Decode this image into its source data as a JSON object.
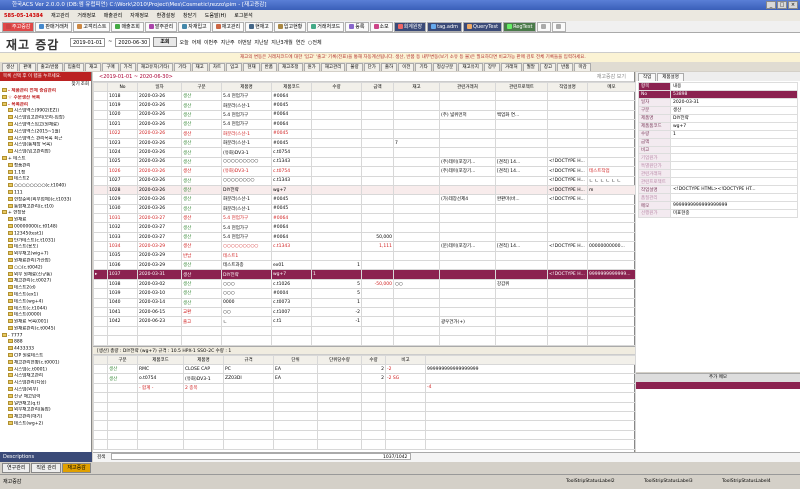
{
  "window": {
    "title": "한국ACS Ver 2.0.0.0 (DB:엠 유럽피언) C:\\Work\\2010\\Project\\Mes\\Cosmetic\\rezzo\\pim - [재고증감]",
    "buttons": [
      "_",
      "□",
      "×"
    ]
  },
  "menu": {
    "brand": "585-05-14384",
    "items": [
      "재고관리",
      "거래정보",
      "매출관리",
      "자재정보",
      "환경설정",
      "창닫기",
      "도움말(H)",
      "로그분석"
    ]
  },
  "toolbar": {
    "items": [
      "주고증감",
      "판매거래처",
      "고객리스트",
      "매출조회",
      "발주관리",
      "자재입고",
      "재고관리",
      "현재고",
      "입고현황",
      "거래처코드",
      "등록",
      "소모",
      "회계원장",
      "tag.adm",
      "QueryTest",
      "RegTest",
      "",
      ""
    ]
  },
  "page": {
    "title": "재고 증감",
    "date_from": "2019-01-01",
    "date_to": "2020-06-30",
    "query_label": "조회",
    "filters": [
      "오늘",
      "어제",
      "이번주",
      "지난주",
      "이번달",
      "지난달",
      "지난3개월",
      "연간",
      "○전체"
    ]
  },
  "notice": "재고의 변동은 거래처코드에 대한 '입고' '출고' 기록(전표)을 통해 자동계산됩니다. 생산, 반품 등 내부변동(보기 소유 등 불)은 필요하다면 비교가능 판매 검토 전체 기록들을 입력하세요.",
  "subtabs": [
    "생산",
    "판매",
    "출고/반품",
    "입출력",
    "재고",
    "구매",
    "가격",
    "재고유지(기타)",
    "기타",
    "재고",
    "차트",
    "입고",
    "현재",
    "반품",
    "재고조정",
    "원가",
    "재고관리",
    "불량",
    "단가",
    "출하",
    "이전",
    "기타",
    "정상구분",
    "재고유지",
    "장부",
    "거래처",
    "월말",
    "창고",
    "반품",
    "마감"
  ],
  "left": {
    "header": "목록 선택 후 이 탭을 누르세요.",
    "search": [
      "찾기",
      "조회"
    ],
    "tree": [
      "- 제품관리 전체 증감관리",
      "☆ 주문생산 목록",
      "- 목록관리",
      "시스템엑스(9902(EZ))",
      "시스템입고관리(보라-입장)",
      "시스템엑스입고(원재료)",
      "시스템엑스(2015~1월)",
      "시스템엑스 관리목록 최근",
      "시스템(통제장 목록)",
      "시스템(입고관리합)",
      "+ 테스트",
      "정품관리",
      "1.1정",
      "테스트2",
      "○○○○○○○○(c.t1040)",
      "111",
      "현장준비(외부업체)(c.t1033)",
      "통합재고관리(c.t10)",
      "+ 현장용",
      "원재료",
      "00000000(c.t0148)",
      "12345(test1)",
      "단가테스트(c.t1031)",
      "테스트(용도)",
      "외부재고(wig+7)",
      "원재료관리(가산합)",
      "○○(c.t0042)",
      "외부 원재료(신규통)",
      "재고관리(c.t0027)",
      "테스트2(d)",
      "테스트(ex1)",
      "테스트(wg+4)",
      "테스트(c.t1044)",
      "테스트(0000)",
      "원재료 목록(001)",
      "원재료관리(c.t0045)",
      "- 7777",
      "888",
      "4433333",
      "CIP 원료테스트",
      "재고관리현황(c.t0001)",
      "시스템(c.t0001)",
      "시스템재고관리",
      "시스템관리(다음)",
      "시스템(외부)",
      "신규 재고입력",
      "일반재고(q.t)",
      "외부재고관리(통합)",
      "재고관리(대기)",
      "테스트(wg+2)"
    ],
    "footer": "Descriptions"
  },
  "grid": {
    "range": "<2019-01-01 ~ 2020-06-30>",
    "range_right": "재고증감 보기",
    "columns": [
      "No",
      "일자",
      "구분",
      "제품명",
      "제품코드",
      "수량",
      "금액",
      "재고",
      "관련거래처",
      "관련프로젝트",
      "작업설명",
      "메모"
    ],
    "rows": [
      {
        "no": "1018",
        "date": "2020-03-26",
        "type": "생산",
        "name": "5.4 현업가구",
        "code": "#0064",
        "qty": "",
        "amt": "",
        "stock": "",
        "partner": "",
        "project": "",
        "desc": "",
        "memo": "",
        "cls": "",
        "typecls": "green",
        "namecls": ""
      },
      {
        "no": "1019",
        "date": "2020-03-26",
        "type": "생산",
        "name": "화분라(스산-1",
        "code": "#0045",
        "qty": "",
        "amt": "",
        "stock": "",
        "partner": "",
        "project": "",
        "desc": "",
        "memo": "",
        "cls": "",
        "typecls": "green",
        "namecls": ""
      },
      {
        "no": "1020",
        "date": "2020-03-26",
        "type": "생산",
        "name": "5.4 현업가구",
        "code": "#0064",
        "qty": "",
        "amt": "",
        "stock": "",
        "partner": "(주) 넓위먼저",
        "project": "백엄화 연...",
        "desc": "",
        "memo": "",
        "cls": "",
        "typecls": "green",
        "namecls": ""
      },
      {
        "no": "1021",
        "date": "2020-03-26",
        "type": "생산",
        "name": "5.4 현업가구",
        "code": "#0064",
        "qty": "",
        "amt": "",
        "stock": "",
        "partner": "",
        "project": "",
        "desc": "",
        "memo": "",
        "cls": "",
        "typecls": "green",
        "namecls": ""
      },
      {
        "no": "1022",
        "date": "2020-03-26",
        "type": "생산",
        "name": "화분라(스산-1",
        "code": "#0045",
        "qty": "",
        "amt": "",
        "stock": "",
        "partner": "",
        "project": "",
        "desc": "",
        "memo": "",
        "cls": "red",
        "typecls": "red",
        "namecls": "red"
      },
      {
        "no": "1023",
        "date": "2020-03-26",
        "type": "생산",
        "name": "화분라(스산-1",
        "code": "#0045",
        "qty": "",
        "amt": "",
        "stock": "7",
        "partner": "",
        "project": "",
        "desc": "",
        "memo": "",
        "cls": "",
        "typecls": "green",
        "namecls": ""
      },
      {
        "no": "1024",
        "date": "2020-03-26",
        "type": "생산",
        "name": "(유화)DV3-1",
        "code": "c.t0754",
        "qty": "",
        "amt": "",
        "stock": "",
        "partner": "",
        "project": "",
        "desc": "",
        "memo": "",
        "cls": "",
        "typecls": "green",
        "namecls": ""
      },
      {
        "no": "1025",
        "date": "2020-03-26",
        "type": "생산",
        "name": "○○○○○○○○○",
        "code": "c.t1343",
        "qty": "",
        "amt": "",
        "stock": "",
        "partner": "(주)데이(포장기...",
        "project": "[견적] 14...",
        "desc": "<!DOCTYPE H...",
        "memo": "",
        "cls": "",
        "typecls": "green",
        "namecls": ""
      },
      {
        "no": "1026",
        "date": "2020-03-26",
        "type": "생산",
        "name": "(유화)DV3-1",
        "code": "c.t0754",
        "qty": "",
        "amt": "",
        "stock": "",
        "partner": "(주)데이(포장기...",
        "project": "[견적] 14...",
        "desc": "<!DOCTYPE H...",
        "memo": "테스트작업",
        "cls": "red",
        "typecls": "red",
        "namecls": "red"
      },
      {
        "no": "1027",
        "date": "2020-03-26",
        "type": "생산",
        "name": "○○○○○○○○",
        "code": "c.t1343",
        "qty": "",
        "amt": "",
        "stock": "",
        "partner": "",
        "project": "",
        "desc": "<!DOCTYPE H...",
        "memo": "ㄴ ㄴ ㄴ ㄴ ㄴ ㄴ",
        "cls": "",
        "typecls": "green",
        "namecls": ""
      },
      {
        "no": "1028",
        "date": "2020-03-26",
        "type": "생산",
        "name": "DIY전략",
        "code": "wg+7",
        "qty": "",
        "amt": "",
        "stock": "",
        "partner": "",
        "project": "",
        "desc": "<!DOCTYPE H...",
        "memo": "m",
        "cls": "pink",
        "typecls": "green",
        "namecls": ""
      },
      {
        "no": "1029",
        "date": "2020-03-26",
        "type": "생산",
        "name": "화분라(스산-1",
        "code": "#0045",
        "qty": "",
        "amt": "",
        "stock": "",
        "partner": "(가)데장선제4",
        "project": "완판마(바...",
        "desc": "<!DOCTYPE H...",
        "memo": "",
        "cls": "",
        "typecls": "green",
        "namecls": ""
      },
      {
        "no": "1030",
        "date": "2020-03-26",
        "type": "생산",
        "name": "화분라(스산-1",
        "code": "#0045",
        "qty": "",
        "amt": "",
        "stock": "",
        "partner": "",
        "project": "",
        "desc": "",
        "memo": "",
        "cls": "",
        "typecls": "green",
        "namecls": ""
      },
      {
        "no": "1031",
        "date": "2020-03-27",
        "type": "생산",
        "name": "5.4 현업가구",
        "code": "#0064",
        "qty": "",
        "amt": "",
        "stock": "",
        "partner": "",
        "project": "",
        "desc": "",
        "memo": "",
        "cls": "red",
        "typecls": "red",
        "namecls": "red"
      },
      {
        "no": "1032",
        "date": "2020-03-27",
        "type": "생산",
        "name": "5.4 현업가구",
        "code": "#0064",
        "qty": "",
        "amt": "",
        "stock": "",
        "partner": "",
        "project": "",
        "desc": "",
        "memo": "",
        "cls": "",
        "typecls": "green",
        "namecls": ""
      },
      {
        "no": "1033",
        "date": "2020-03-27",
        "type": "생산",
        "name": "5.4 현업가구",
        "code": "#0064",
        "qty": "",
        "amt": "50,000",
        "stock": "",
        "partner": "",
        "project": "",
        "desc": "",
        "memo": "",
        "cls": "",
        "typecls": "green",
        "namecls": ""
      },
      {
        "no": "1034",
        "date": "2020-03-29",
        "type": "생산",
        "name": "○○○○○○○○○",
        "code": "c.t1343",
        "qty": "",
        "amt": "1,111",
        "stock": "",
        "partner": "(문)데이(포장기...",
        "project": "[견적] 14...",
        "desc": "<!DOCTYPE H...",
        "memo": "00000000000...",
        "cls": "red",
        "typecls": "red",
        "namecls": "red"
      },
      {
        "no": "1035",
        "date": "2020-03-29",
        "type": "반납",
        "name": "테스트1",
        "code": "",
        "qty": "",
        "amt": "",
        "stock": "",
        "partner": "",
        "project": "",
        "desc": "",
        "memo": "",
        "cls": "",
        "typecls": "red",
        "namecls": "red"
      },
      {
        "no": "1036",
        "date": "2020-03-29",
        "type": "생산",
        "name": "테스트과종",
        "code": "ex01",
        "qty": "1",
        "amt": "",
        "stock": "",
        "partner": "",
        "project": "",
        "desc": "",
        "memo": "",
        "cls": "",
        "typecls": "green",
        "namecls": ""
      },
      {
        "no": "1037",
        "date": "2020-03-31",
        "type": "생산",
        "name": "DIY전략",
        "code": "wg+7",
        "qty": "1",
        "amt": "",
        "stock": "",
        "partner": "",
        "project": "",
        "desc": "<!DOCTYPE H...",
        "memo": "9999999999999...",
        "cls": "sel",
        "typecls": "",
        "namecls": ""
      },
      {
        "no": "1038",
        "date": "2020-03-02",
        "type": "생산",
        "name": "○○○",
        "code": "c.t1026",
        "qty": "5",
        "amt": "-50,000",
        "stock": "○○",
        "partner": "",
        "project": "강갑위",
        "desc": "",
        "memo": "",
        "cls": "",
        "typecls": "green",
        "namecls": ""
      },
      {
        "no": "1039",
        "date": "2020-03-10",
        "type": "생산",
        "name": "○○○",
        "code": "#0004",
        "qty": "5",
        "amt": "",
        "stock": "",
        "partner": "",
        "project": "",
        "desc": "",
        "memo": "",
        "cls": "",
        "typecls": "green",
        "namecls": ""
      },
      {
        "no": "1040",
        "date": "2020-03-14",
        "type": "생산",
        "name": "0000",
        "code": "c.t0073",
        "qty": "1",
        "amt": "",
        "stock": "",
        "partner": "",
        "project": "",
        "desc": "",
        "memo": "",
        "cls": "",
        "typecls": "green",
        "namecls": ""
      },
      {
        "no": "1041",
        "date": "2020-06-15",
        "type": "교환",
        "name": "○○",
        "code": "c.t1007",
        "qty": "-2",
        "amt": "",
        "stock": "",
        "partner": "",
        "project": "",
        "desc": "",
        "memo": "",
        "cls": "",
        "typecls": "red",
        "namecls": ""
      },
      {
        "no": "1042",
        "date": "2020-06-23",
        "type": "출고",
        "name": "ㄴ",
        "code": "c.t1",
        "qty": "-1",
        "amt": "",
        "stock": "",
        "partner": "광우건가(+)",
        "project": "",
        "desc": "",
        "memo": "",
        "cls": "",
        "typecls": "red",
        "namecls": ""
      }
    ],
    "sub_header": "[생산] 총량 : DIY전략 (wg+7) 규격 : 10.5 HPX-1 SSO-2C 수량 : 1",
    "sub_columns": [
      "구분",
      "제품코드",
      "제품명",
      "규격",
      "단위",
      "단위당수량",
      "수량",
      "비고"
    ],
    "sub_rows": [
      {
        "type": "생산",
        "code": "RMC",
        "name": "CLOSE CAP",
        "spec": "PC",
        "unit": "EA",
        "per": "",
        "qty": "2",
        "note": "-2"
      },
      {
        "type": "생산",
        "code": "o.t0754",
        "name": "(유화)DV3-1",
        "spec": "ZZ03DI",
        "unit": "EA",
        "per": "",
        "qty": "2",
        "note": "-2 SG"
      }
    ],
    "sub_total": {
      "label": "- 합계 -",
      "count": "2 종목",
      "qty": "",
      "note": "-4"
    },
    "sub_memo": "999999999999999999"
  },
  "right": {
    "tabs": [
      "작업",
      "제품설명"
    ],
    "head": [
      "항목",
      "내용"
    ],
    "props": [
      [
        "No",
        "53898"
      ],
      [
        "일자",
        "2020-03-31"
      ],
      [
        "구분",
        "생산"
      ],
      [
        "제품명",
        "DIY전략"
      ],
      [
        "제품품코드",
        "wg+7"
      ],
      [
        "수량",
        "1"
      ],
      [
        "금액",
        ""
      ],
      [
        "비고",
        ""
      ],
      [
        "기업원가",
        ""
      ],
      [
        "특별원단가",
        ""
      ],
      [
        "관련거래처",
        ""
      ],
      [
        "관련프로젝트",
        ""
      ],
      [
        "작업설명",
        "<!DOCTYPE HTML><!DOCTYPE HT..."
      ],
      [
        "품질관리",
        ""
      ],
      [
        "메모",
        "9999999999999999999"
      ],
      [
        "선행원가",
        "미표현중"
      ]
    ],
    "note_header": "추가 메모"
  },
  "bottom": {
    "label": "검색",
    "count": "1037/1042"
  },
  "taskbar": [
    "연구관리",
    "직원 관리",
    "재고증감"
  ],
  "status": {
    "left": "재고증감",
    "labels": [
      "ToolStripStatusLabel2",
      "ToolStripStatusLabel3",
      "ToolStripStatusLabel4"
    ]
  }
}
